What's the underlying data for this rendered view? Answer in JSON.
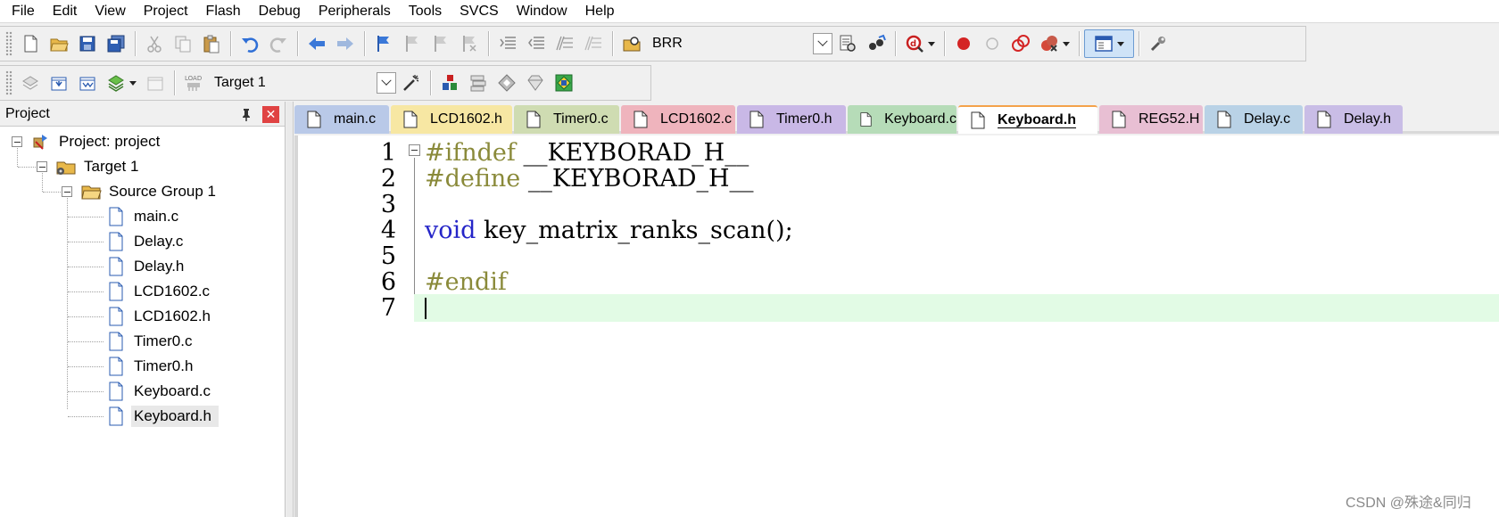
{
  "menu": [
    "File",
    "Edit",
    "View",
    "Project",
    "Flash",
    "Debug",
    "Peripherals",
    "Tools",
    "SVCS",
    "Window",
    "Help"
  ],
  "toolbar1": {
    "find_text": "BRR"
  },
  "toolbar2": {
    "target": "Target 1",
    "load_label": "LOAD"
  },
  "project_panel": {
    "title": "Project",
    "close_glyph": "✕",
    "root": "Project: project",
    "target": "Target 1",
    "group": "Source Group 1",
    "files": [
      "main.c",
      "Delay.c",
      "Delay.h",
      "LCD1602.c",
      "LCD1602.h",
      "Timer0.c",
      "Timer0.h",
      "Keyboard.c",
      "Keyboard.h"
    ],
    "selected_file": "Keyboard.h"
  },
  "tabs": [
    {
      "label": "main.c",
      "color": "#b9c9e8"
    },
    {
      "label": "LCD1602.h",
      "color": "#f7e7a3"
    },
    {
      "label": "Timer0.c",
      "color": "#cfdcb2"
    },
    {
      "label": "LCD1602.c",
      "color": "#efb4bd"
    },
    {
      "label": "Timer0.h",
      "color": "#c9b8e6"
    },
    {
      "label": "Keyboard.c",
      "color": "#b6dcb8"
    },
    {
      "label": "Keyboard.h",
      "color": "#ffffff"
    },
    {
      "label": "REG52.H",
      "color": "#e8bfd3"
    },
    {
      "label": "Delay.c",
      "color": "#b9d2e6"
    },
    {
      "label": "Delay.h",
      "color": "#c9bde6"
    }
  ],
  "active_tab": "Keyboard.h",
  "editor": {
    "lines": [
      {
        "num": "1",
        "parts": [
          {
            "text": "#ifndef",
            "cls": "kw-pre"
          },
          {
            "text": " __KEYBORAD_H__",
            "cls": "plain"
          }
        ]
      },
      {
        "num": "2",
        "parts": [
          {
            "text": "#define",
            "cls": "kw-pre"
          },
          {
            "text": " __KEYBORAD_H__",
            "cls": "plain"
          }
        ]
      },
      {
        "num": "3",
        "parts": []
      },
      {
        "num": "4",
        "parts": [
          {
            "text": "void",
            "cls": "kw-type"
          },
          {
            "text": " key_matrix_ranks_scan();",
            "cls": "plain"
          }
        ]
      },
      {
        "num": "5",
        "parts": []
      },
      {
        "num": "6",
        "parts": [
          {
            "text": "#endif",
            "cls": "kw-pre"
          }
        ]
      },
      {
        "num": "7",
        "parts": []
      }
    ],
    "current_line": 7
  },
  "watermark": "CSDN @殊途&同归"
}
